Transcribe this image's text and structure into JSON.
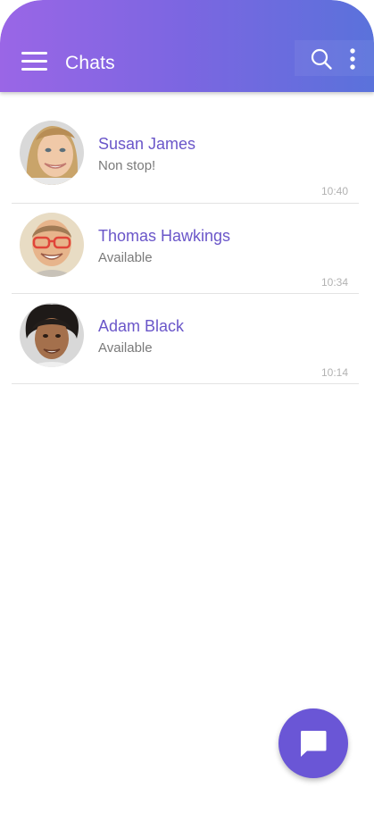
{
  "header": {
    "title": "Chats",
    "menu_icon": "hamburger-menu-icon",
    "search_icon": "search-icon",
    "more_icon": "more-vertical-icon"
  },
  "chats": [
    {
      "name": "Susan James",
      "status": "Non stop!",
      "time": "10:40",
      "avatar": "avatar-woman-blonde"
    },
    {
      "name": "Thomas Hawkings",
      "status": "Available",
      "time": "10:34",
      "avatar": "avatar-man-glasses"
    },
    {
      "name": "Adam Black",
      "status": "Available",
      "time": "10:14",
      "avatar": "avatar-man-curly-hair"
    }
  ],
  "fab": {
    "icon": "chat-bubble-icon"
  },
  "colors": {
    "header_gradient_start": "#9a66e6",
    "header_gradient_end": "#5a72db",
    "accent": "#6a56d6",
    "name_text": "#6a56c9",
    "status_text": "#7a7a7a",
    "time_text": "#b2b2b2",
    "divider": "#e3e3e3"
  }
}
